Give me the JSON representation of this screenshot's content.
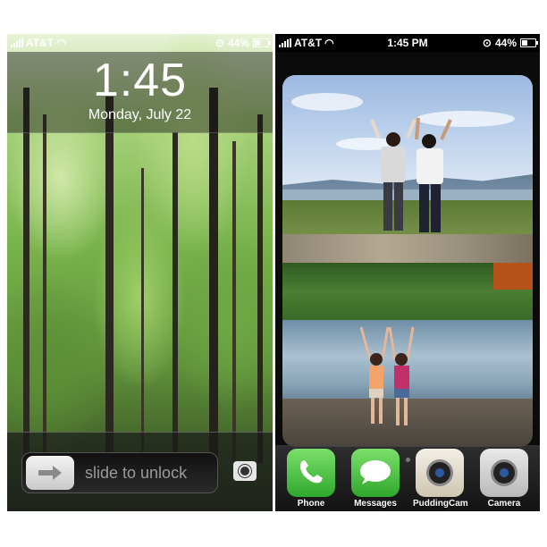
{
  "lock_screen": {
    "status": {
      "carrier": "AT&T",
      "battery": "44%"
    },
    "time": "1:45",
    "date": "Monday, July 22",
    "unlock_text": "slide to unlock",
    "battery_level": 0.44
  },
  "home_screen": {
    "status": {
      "carrier": "AT&T",
      "time": "1:45 PM",
      "battery": "44%"
    },
    "dock": [
      {
        "label": "Phone",
        "icon": "phone-icon"
      },
      {
        "label": "Messages",
        "icon": "messages-icon"
      },
      {
        "label": "PuddingCam",
        "icon": "puddingcam-icon"
      },
      {
        "label": "Camera",
        "icon": "camera-icon"
      }
    ],
    "battery_level": 0.44
  },
  "colors": {
    "accent_green": "#2fa82c",
    "dock_bg": "#1a1a1a"
  }
}
